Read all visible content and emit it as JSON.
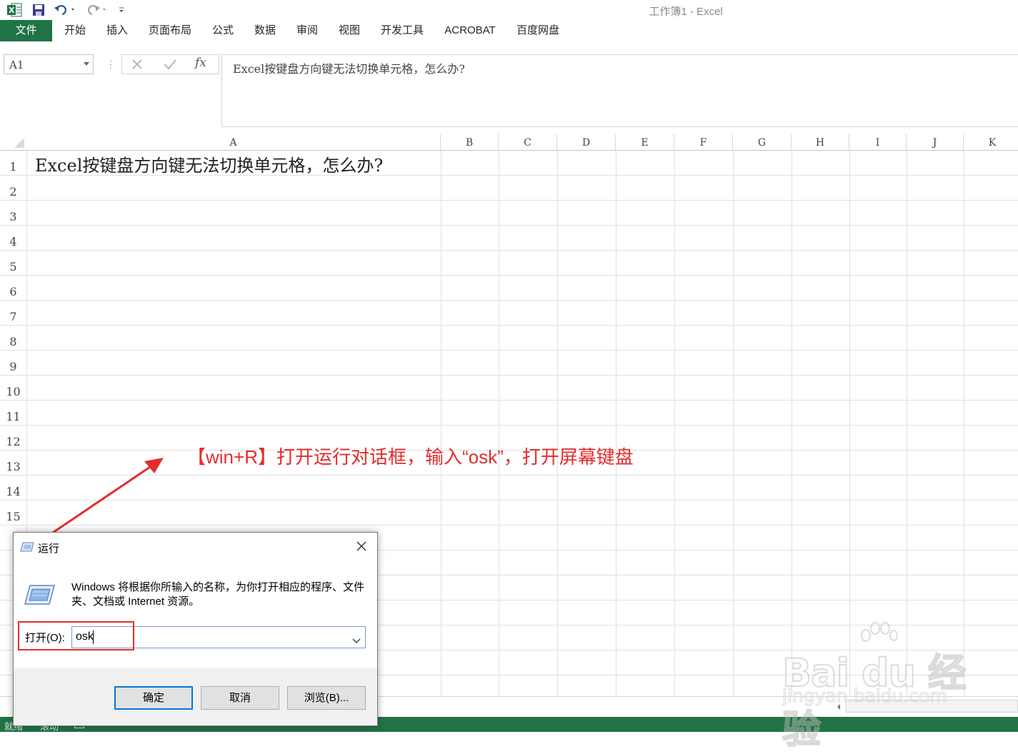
{
  "window": {
    "title": "工作簿1 - Excel"
  },
  "ribbon": {
    "tabs": [
      "文件",
      "开始",
      "插入",
      "页面布局",
      "公式",
      "数据",
      "审阅",
      "视图",
      "开发工具",
      "ACROBAT",
      "百度网盘"
    ]
  },
  "formula_bar": {
    "name_box": "A1",
    "fx_label": "fx",
    "content": "Excel按键盘方向键无法切换单元格，怎么办?"
  },
  "grid": {
    "columns": [
      "A",
      "B",
      "C",
      "D",
      "E",
      "F",
      "G",
      "H",
      "I",
      "J",
      "K"
    ],
    "rows": [
      "1",
      "2",
      "3",
      "4",
      "5",
      "6",
      "7",
      "8",
      "9",
      "10",
      "11",
      "12",
      "13",
      "14",
      "15"
    ],
    "cell_a1": "Excel按键盘方向键无法切换单元格，怎么办?"
  },
  "annotation": {
    "text": "【win+R】打开运行对话框，输入“osk”，打开屏幕键盘",
    "color": "#e32d2d"
  },
  "run_dialog": {
    "title": "运行",
    "description": "Windows 将根据你所输入的名称，为你打开相应的程序、文件夹、文档或 Internet 资源。",
    "open_label": "打开(O):",
    "input_value": "osk",
    "ok_label": "确定",
    "cancel_label": "取消",
    "browse_label": "浏览(B)..."
  },
  "status_bar": {
    "ready": "就绪",
    "scroll": "滚动"
  },
  "watermark": {
    "brand": "Bai du 经验",
    "url": "jingyan.baidu.com"
  },
  "colors": {
    "excel_green": "#217346",
    "accent_blue": "#0078d7",
    "annotation_red": "#e32d2d"
  }
}
